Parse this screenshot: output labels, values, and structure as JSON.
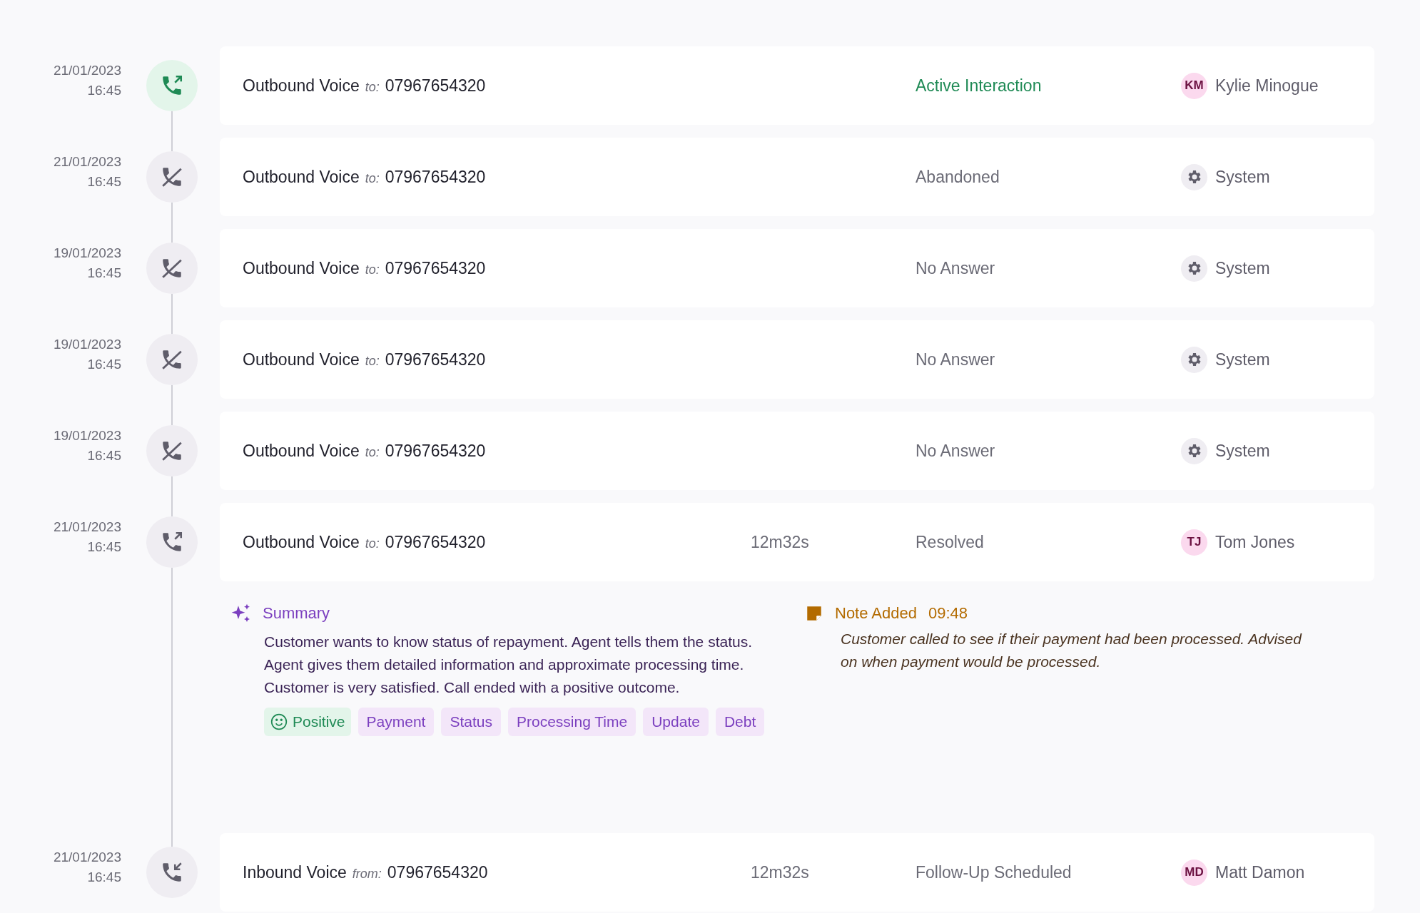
{
  "interactions": [
    {
      "date": "21/01/2023",
      "time": "16:45",
      "kind": "outbound",
      "active": true,
      "channel": "Outbound Voice",
      "preposition": "to:",
      "number": "07967654320",
      "status": "Active Interaction",
      "agent": {
        "kind": "person",
        "initials": "KM",
        "name": "Kylie Minogue"
      }
    },
    {
      "date": "21/01/2023",
      "time": "16:45",
      "kind": "missed",
      "active": false,
      "channel": "Outbound Voice",
      "preposition": "to:",
      "number": "07967654320",
      "status": "Abandoned",
      "agent": {
        "kind": "system",
        "name": "System"
      }
    },
    {
      "date": "19/01/2023",
      "time": "16:45",
      "kind": "missed",
      "active": false,
      "channel": "Outbound Voice",
      "preposition": "to:",
      "number": "07967654320",
      "status": "No Answer",
      "agent": {
        "kind": "system",
        "name": "System"
      }
    },
    {
      "date": "19/01/2023",
      "time": "16:45",
      "kind": "missed",
      "active": false,
      "channel": "Outbound Voice",
      "preposition": "to:",
      "number": "07967654320",
      "status": "No Answer",
      "agent": {
        "kind": "system",
        "name": "System"
      }
    },
    {
      "date": "19/01/2023",
      "time": "16:45",
      "kind": "missed",
      "active": false,
      "channel": "Outbound Voice",
      "preposition": "to:",
      "number": "07967654320",
      "status": "No Answer",
      "agent": {
        "kind": "system",
        "name": "System"
      }
    },
    {
      "date": "21/01/2023",
      "time": "16:45",
      "kind": "outbound",
      "active": false,
      "channel": "Outbound Voice",
      "preposition": "to:",
      "number": "07967654320",
      "duration": "12m32s",
      "status": "Resolved",
      "agent": {
        "kind": "person",
        "initials": "TJ",
        "name": "Tom Jones"
      },
      "details": {
        "summary_title": "Summary",
        "summary": "Customer wants to know status of repayment. Agent tells them the status. Agent gives them detailed information and approximate processing time. Customer is very satisfied. Call ended with a positive outcome.",
        "tags": [
          {
            "kind": "sentiment",
            "label": "Positive"
          },
          {
            "kind": "topic",
            "label": "Payment"
          },
          {
            "kind": "topic",
            "label": "Status"
          },
          {
            "kind": "topic",
            "label": "Processing Time"
          },
          {
            "kind": "topic",
            "label": "Update"
          },
          {
            "kind": "topic",
            "label": "Debt"
          }
        ],
        "note_title": "Note Added",
        "note_time": "09:48",
        "note": "Customer called to see if their payment had been processed. Advised on when payment would be processed."
      }
    },
    {
      "date": "21/01/2023",
      "time": "16:45",
      "kind": "inbound",
      "active": false,
      "channel": "Inbound Voice",
      "preposition": "from:",
      "number": "07967654320",
      "duration": "12m32s",
      "status": "Follow-Up Scheduled",
      "agent": {
        "kind": "person",
        "initials": "MD",
        "name": "Matt Damon"
      }
    }
  ]
}
